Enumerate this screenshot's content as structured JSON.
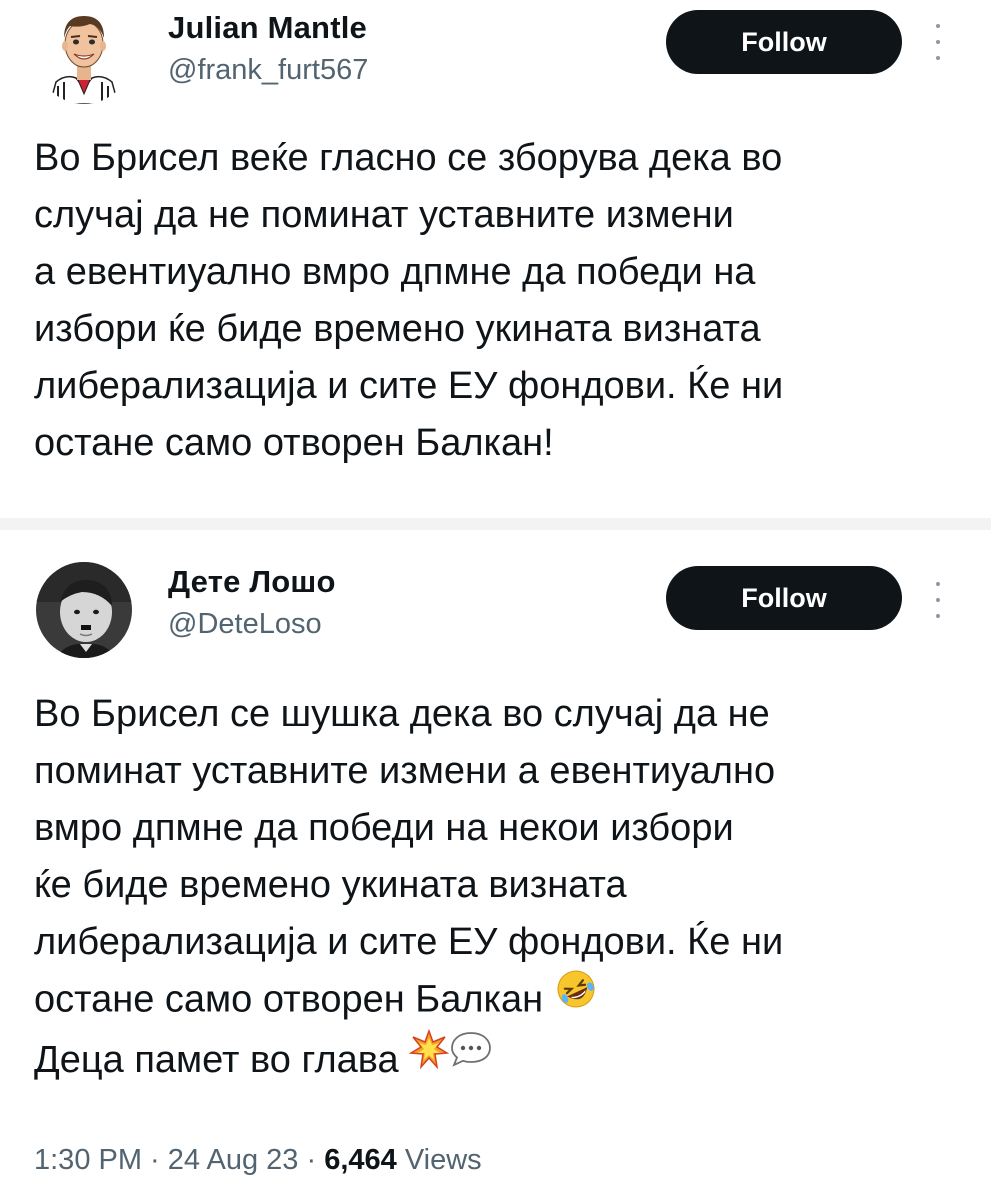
{
  "tweets": [
    {
      "user": {
        "display_name": "Julian Mantle",
        "handle": "@frank_furt567"
      },
      "follow_label": "Follow",
      "text_lines": [
        "Во Брисел веќе гласно се зборува дека во",
        "случај да не поминат уставните измени",
        "а евентиуално вмро дпмне да победи на",
        "избори ќе биде времено укината визната",
        "либерализација и сите ЕУ фондови. Ќе ни",
        "остане само  отворен Балкан!"
      ]
    },
    {
      "user": {
        "display_name": "Дете Лошо",
        "handle": "@DeteLoso"
      },
      "follow_label": "Follow",
      "text_lines": [
        "Во Брисел се шушка дека во случај да не",
        "поминат уставните измени а евентиуално",
        "вмро дпмне да победи на некои избори",
        "ќе биде времено укината визната",
        "либерализација и сите ЕУ фондови. Ќе ни",
        "остане само  отворен Балкан ",
        "Деца памет во глава "
      ],
      "emojis": [
        "rolling-on-floor-laughing-emoji",
        "collision-emoji",
        "speech-balloon-emoji"
      ],
      "meta": {
        "time": "1:30 PM",
        "separator": " · ",
        "date": "24 Aug 23",
        "views_count": "6,464",
        "views_label": " Views"
      }
    }
  ],
  "colors": {
    "text": "#0f1419",
    "secondary": "#536471",
    "button_bg": "#0f1419",
    "button_text": "#ffffff",
    "divider": "#f3f3f3"
  }
}
